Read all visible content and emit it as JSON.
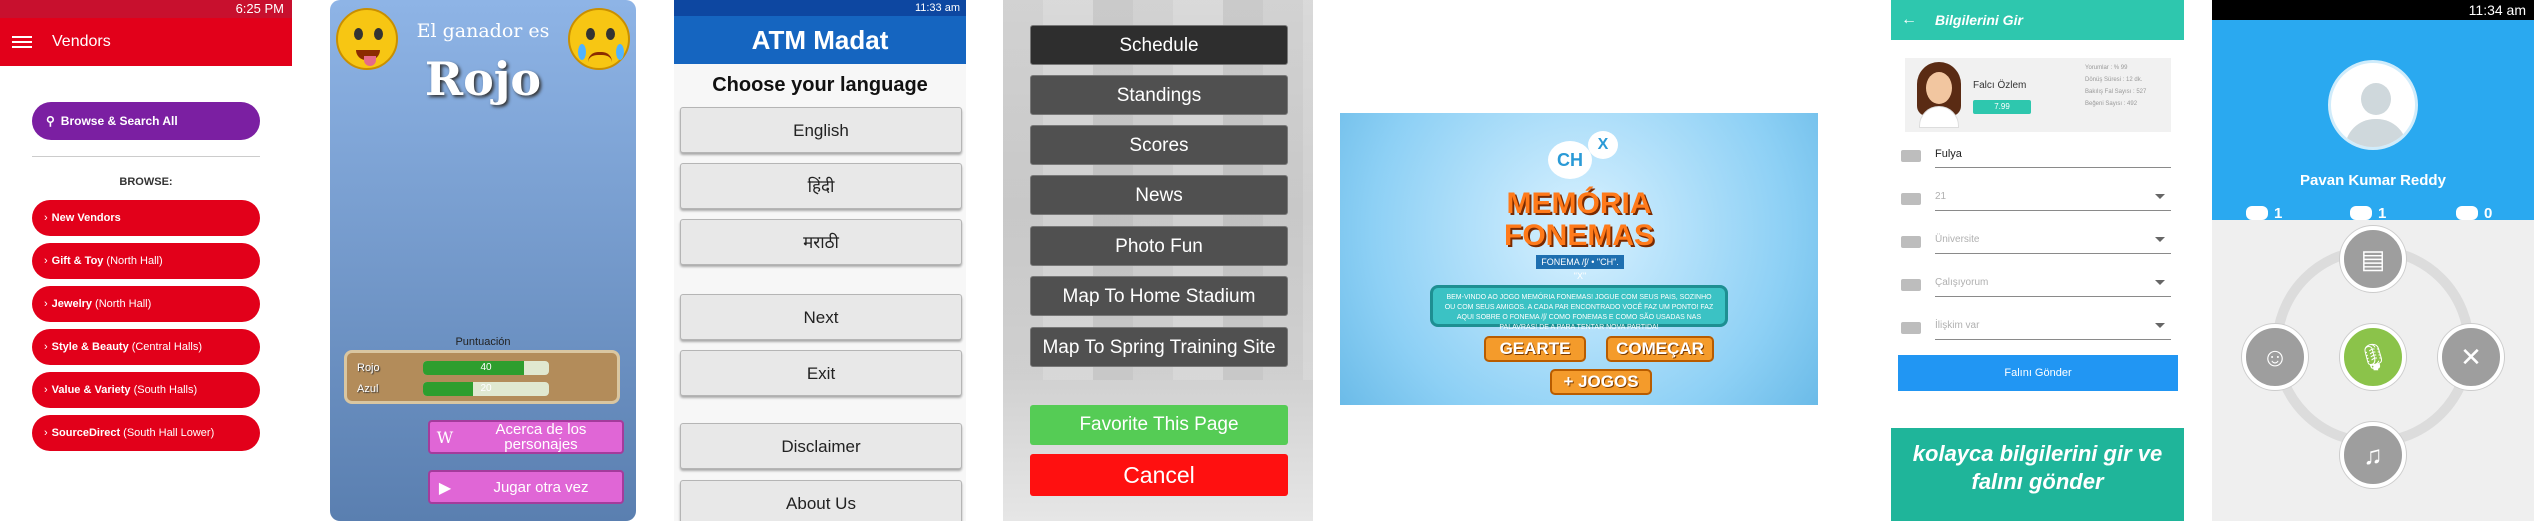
{
  "vendors_app": {
    "status_time": "6:25 PM",
    "title": "Vendors",
    "search_label": "Browse & Search All",
    "browse_label": "BROWSE:",
    "items": [
      {
        "bold": "New Vendors",
        "rest": ""
      },
      {
        "bold": "Gift & Toy",
        "rest": "(North Hall)"
      },
      {
        "bold": "Jewelry",
        "rest": "(North Hall)"
      },
      {
        "bold": "Style & Beauty",
        "rest": "(Central Halls)"
      },
      {
        "bold": "Value & Variety",
        "rest": "(South Halls)"
      },
      {
        "bold": "SourceDirect",
        "rest": "(South Hall Lower)"
      }
    ]
  },
  "winner_app": {
    "title": "El ganador es",
    "winner": "Rojo",
    "score_label": "Puntuación",
    "scores": [
      {
        "name": "Rojo",
        "value": "40",
        "fraction": 0.8
      },
      {
        "name": "Azul",
        "value": "20",
        "fraction": 0.4
      }
    ],
    "btn_more": "Acerca de los personajes",
    "btn_more_glyph": "W",
    "btn_play": "Jugar otra vez",
    "btn_play_glyph": "▶"
  },
  "atm_app": {
    "status_time": "11:33 am",
    "title": "ATM Madat",
    "subtitle": "Choose your language",
    "buttons": [
      "English",
      "हिंदी",
      "मराठी",
      "Next",
      "Exit",
      "Disclaimer",
      "About Us"
    ]
  },
  "menu_app": {
    "items": [
      "Schedule",
      "Standings",
      "Scores",
      "News",
      "Photo Fun",
      "Map To Home Stadium",
      "Map To Spring Training Site"
    ],
    "favorite": "Favorite This Page",
    "cancel": "Cancel"
  },
  "memoria_app": {
    "bubble1": "CH",
    "bubble2": "X",
    "logo_line1": "MEMÓRIA",
    "logo_line2": "FONEMAS",
    "logo_sub": "FONEMA /ʃ/ • \"CH\". \"X\"",
    "intro": "BEM-VINDO AO JOGO MEMÓRIA FONEMAS! JOGUE COM SEUS PAIS, SOZINHO OU COM SEUS AMIGOS. A CADA PAR ENCONTRADO VOCÊ FAZ UM PONTO! FAZ AQUI SOBRE O FONEMA /ʃ/ COMO FONEMAS E COMO SÃO USADAS NAS PALAVRAS! DE A PARA TENTAR NOVA PARTIDA!",
    "btn_gearte": "GEARTE",
    "btn_comecar": "COMEÇAR",
    "btn_jogos": "+ JOGOS"
  },
  "bilgi_app": {
    "title": "Bilgilerini Gir",
    "profile_name": "Falcı Özlem",
    "profile_badge": "7.99",
    "profile_stats": [
      "Yorumlar : % 99",
      "Dönüş Süresi : 12 dk.",
      "Bakılış Fal Sayısı : 527",
      "Beğeni Sayısı : 492"
    ],
    "field_name": "Fulya",
    "field_age": "21",
    "field_school": "Üniversite",
    "field_job": "Çalışıyorum",
    "field_relation": "İlişkim var",
    "submit": "Falını Gönder",
    "banner": "kolayca bilgilerini gir ve falını gönder"
  },
  "pavan_app": {
    "status_time": "11:34 am",
    "user": "Pavan Kumar Reddy",
    "stats": [
      "1",
      "1",
      "0"
    ]
  }
}
